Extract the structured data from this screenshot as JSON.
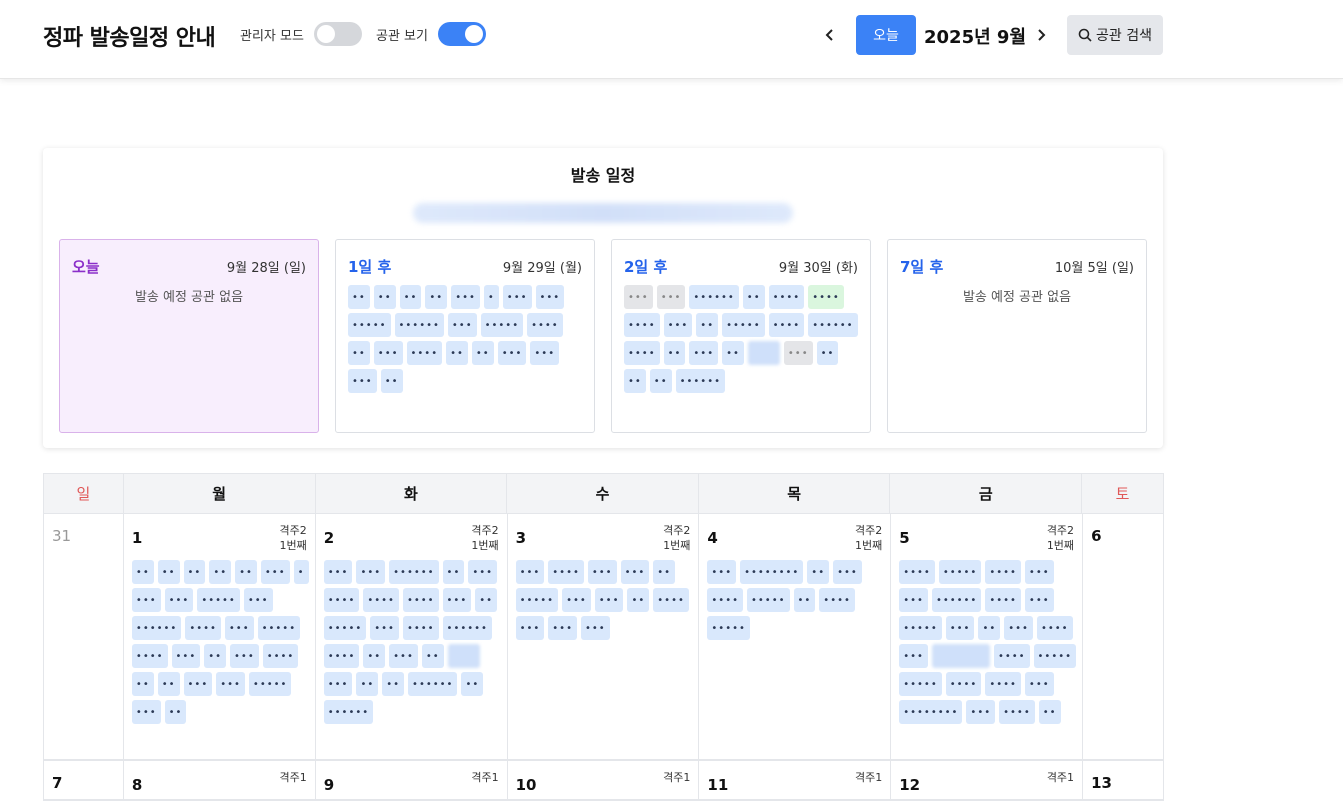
{
  "header": {
    "title": "정파 발송일정 안내",
    "admin_mode_label": "관리자 모드",
    "admin_mode_on": false,
    "library_view_label": "공관 보기",
    "library_view_on": true,
    "prev_icon": "chevron-left-icon",
    "today_label": "오늘",
    "month_label": "2025년 9월",
    "next_icon": "chevron-right-icon",
    "search_label": "공관 검색",
    "search_icon": "search-icon",
    "accent_color": "#3b82f6"
  },
  "schedule": {
    "title": "발송 일정",
    "cards": [
      {
        "relative": "오늘",
        "date": "9월 28일 (일)",
        "empty": "발송 예정 공관 없음",
        "chips": []
      },
      {
        "relative": "1일 후",
        "date": "9월 29일 (월)",
        "empty": "",
        "chips": [
          "••",
          "••",
          "••",
          "••",
          "•••",
          "•",
          "•••",
          "•••",
          "•••••",
          "••••••",
          "•••",
          "•••••",
          "••••",
          "••",
          "•••",
          "••••",
          "••",
          "••",
          "•••",
          "•••",
          "•••",
          "••"
        ]
      },
      {
        "relative": "2일 후",
        "date": "9월 30일 (화)",
        "empty": "",
        "chips": [
          "•••",
          "•••",
          "••••••",
          "••",
          "••••",
          "••••",
          "••••",
          "•••",
          "••",
          "•••••",
          "••••",
          "••••••",
          "••••",
          "••",
          "•••",
          "••",
          "",
          "•••",
          "••",
          "••",
          "••",
          "••••••"
        ]
      },
      {
        "relative": "7일 후",
        "date": "10월 5일 (일)",
        "empty": "발송 예정 공관 없음",
        "chips": []
      }
    ]
  },
  "calendar": {
    "weekdays": [
      "일",
      "월",
      "화",
      "수",
      "목",
      "금",
      "토"
    ],
    "week1": [
      {
        "day": "31",
        "week_line1": "",
        "week_line2": "",
        "chips": []
      },
      {
        "day": "1",
        "week_line1": "격주2",
        "week_line2": "1번째",
        "chips": [
          "••",
          "••",
          "••",
          "••",
          "••",
          "•••",
          "•",
          "•••",
          "•••",
          "•••••",
          "•••",
          "••••••",
          "••••",
          "•••",
          "•••••",
          "••••",
          "•••",
          "••",
          "•••",
          "••••",
          "••",
          "••",
          "•••",
          "•••",
          "•••••",
          "•••",
          "••"
        ]
      },
      {
        "day": "2",
        "week_line1": "격주2",
        "week_line2": "1번째",
        "chips": [
          "•••",
          "•••",
          "••••••",
          "••",
          "•••",
          "••••",
          "••••",
          "••••",
          "•••",
          "••",
          "•••••",
          "•••",
          "••••",
          "••••••",
          "••••",
          "••",
          "•••",
          "••",
          "",
          "•••",
          "••",
          "••",
          "••••••",
          "••",
          "••••••"
        ]
      },
      {
        "day": "3",
        "week_line1": "격주2",
        "week_line2": "1번째",
        "chips": [
          "•••",
          "••••",
          "•••",
          "•••",
          "••",
          "•••••",
          "•••",
          "•••",
          "••",
          "••••",
          "•••",
          "•••",
          "•••"
        ]
      },
      {
        "day": "4",
        "week_line1": "격주2",
        "week_line2": "1번째",
        "chips": [
          "•••",
          "••••••••",
          "••",
          "•••",
          "••••",
          "•••••",
          "••",
          "••••",
          "•••••"
        ]
      },
      {
        "day": "5",
        "week_line1": "격주2",
        "week_line2": "1번째",
        "chips": [
          "••••",
          "•••••",
          "••••",
          "•••",
          "•••",
          "••••••",
          "••••",
          "•••",
          "•••••",
          "•••",
          "••",
          "•••",
          "••••",
          "•••",
          "",
          "••••",
          "•••••",
          "•••••",
          "••••",
          "••••",
          "•••",
          "••••••••",
          "•••",
          "••••",
          "••"
        ]
      },
      {
        "day": "6",
        "week_line1": "",
        "week_line2": "",
        "chips": []
      }
    ],
    "week2": [
      {
        "day": "7",
        "week_line1": ""
      },
      {
        "day": "8",
        "week_line1": "격주1"
      },
      {
        "day": "9",
        "week_line1": "격주1"
      },
      {
        "day": "10",
        "week_line1": "격주1"
      },
      {
        "day": "11",
        "week_line1": "격주1"
      },
      {
        "day": "12",
        "week_line1": "격주1"
      },
      {
        "day": "13",
        "week_line1": ""
      }
    ]
  }
}
